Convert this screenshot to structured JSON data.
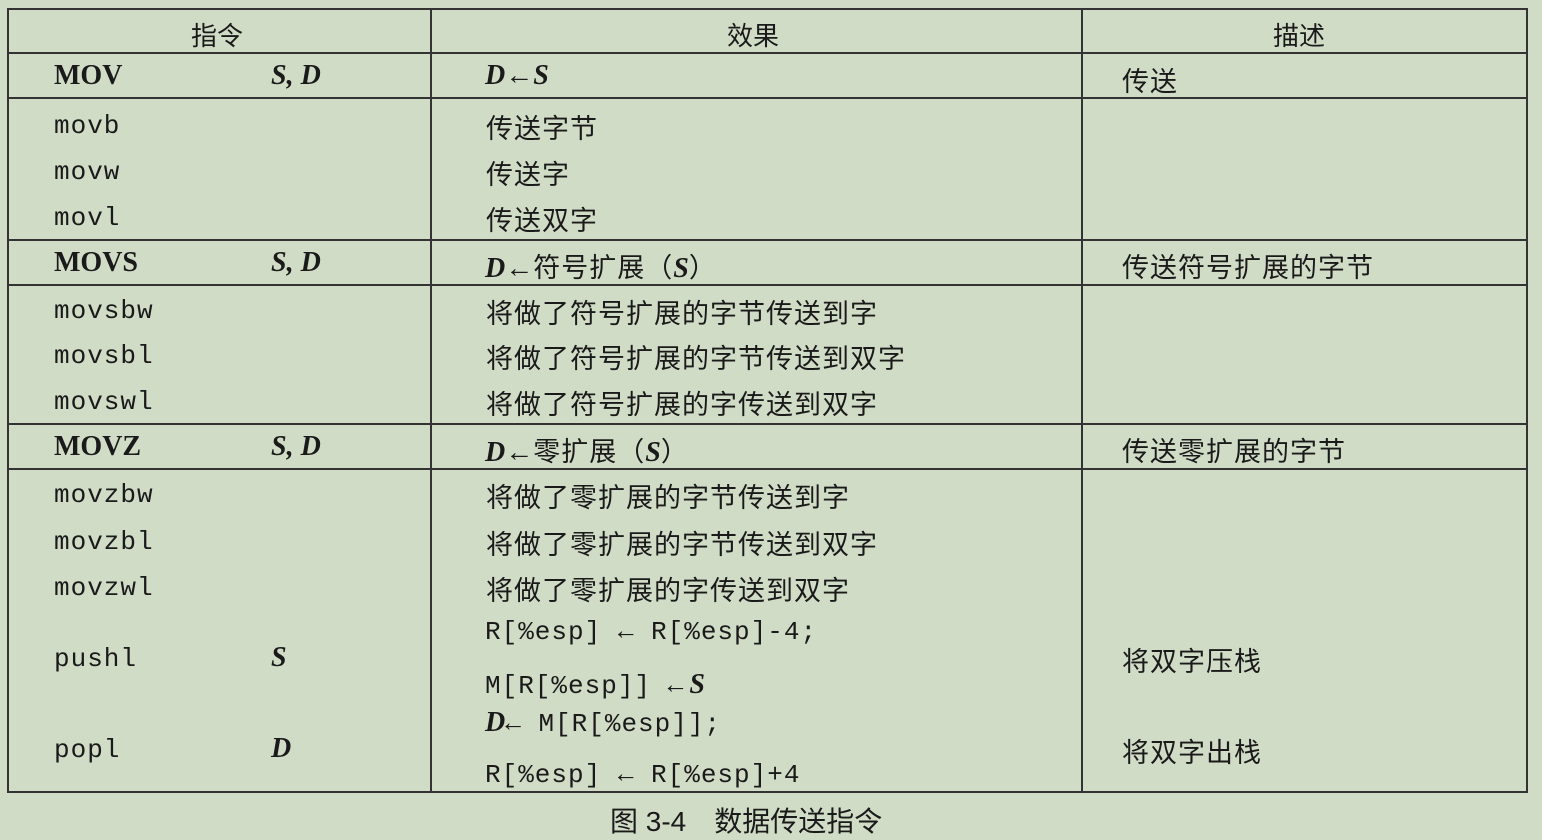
{
  "headers": [
    "指令",
    "效果",
    "描述"
  ],
  "rows": [
    {
      "instr": "MOV",
      "operands": "S, D",
      "effect_pre": "D",
      "arrow": "←",
      "effect_post": "S",
      "desc": "传送"
    },
    {
      "instr": "movb",
      "effect": "传送字节"
    },
    {
      "instr": "movw",
      "effect": "传送字"
    },
    {
      "instr": "movl",
      "effect": "传送双字"
    },
    {
      "instr": "MOVS",
      "operands": "S, D",
      "effect_pre": "D",
      "arrow": "←",
      "effect_mid": "符号扩展（",
      "effect_var": "S",
      "effect_end": "）",
      "desc": "传送符号扩展的字节"
    },
    {
      "instr": "movsbw",
      "effect": "将做了符号扩展的字节传送到字"
    },
    {
      "instr": "movsbl",
      "effect": "将做了符号扩展的字节传送到双字"
    },
    {
      "instr": "movswl",
      "effect": "将做了符号扩展的字传送到双字"
    },
    {
      "instr": "MOVZ",
      "operands": "S, D",
      "effect_pre": "D",
      "arrow": "←",
      "effect_mid": "零扩展（",
      "effect_var": "S",
      "effect_end": "）",
      "desc": "传送零扩展的字节"
    },
    {
      "instr": "movzbw",
      "effect": "将做了零扩展的字节传送到字"
    },
    {
      "instr": "movzbl",
      "effect": "将做了零扩展的字节传送到双字"
    },
    {
      "instr": "movzwl",
      "effect": "将做了零扩展的字传送到双字"
    },
    {
      "instr": "pushl",
      "operands": "S",
      "effect_line1": "R[%esp] ← R[%esp]-4;",
      "effect_line2_code": "M[R[%esp]] ←",
      "effect_line2_var": "S",
      "desc": "将双字压栈"
    },
    {
      "instr": "popl",
      "operands": "D",
      "effect_line1_var": "D",
      "effect_line1_code": "← M[R[%esp]];",
      "effect_line2": "R[%esp] ← R[%esp]+4",
      "desc": "将双字出栈"
    }
  ],
  "caption": {
    "number": "图 3-4",
    "title": "数据传送指令"
  }
}
